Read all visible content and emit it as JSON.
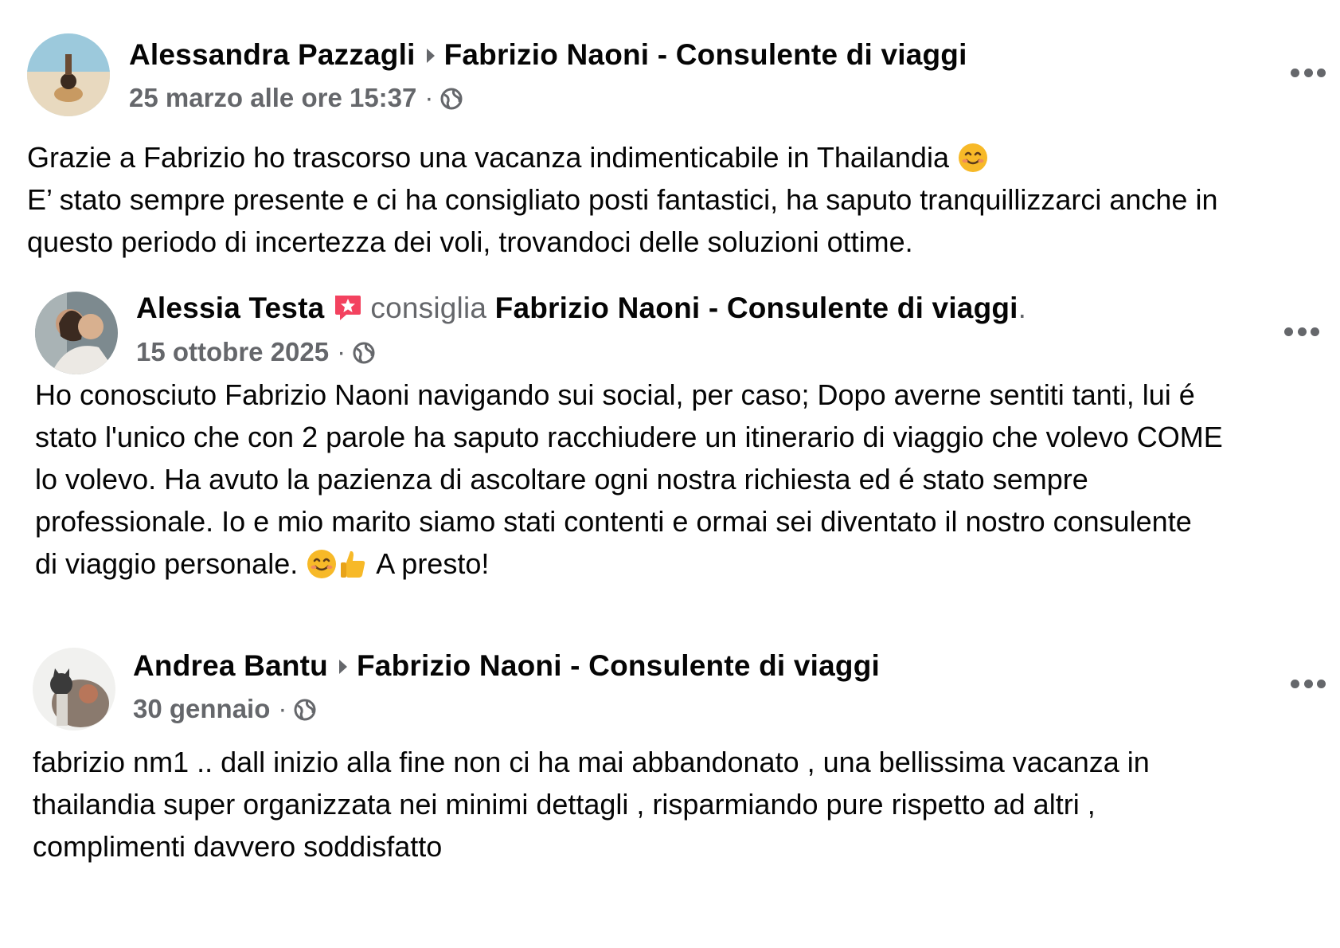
{
  "posts": [
    {
      "author": "Alessandra Pazzagli",
      "page": "Fabrizio Naoni - Consulente di viaggi",
      "date": "25 marzo alle ore 15:37",
      "separator": "·",
      "privacy_icon": "globe-icon",
      "lines": [
        "Grazie a Fabrizio ho trascorso una vacanza indimenticabile in Thailandia",
        "E’ stato sempre presente e ci ha consigliato posti fantastici, ha saputo tranquillizzarci anche in",
        "questo periodo di incertezza dei voli, trovandoci delle soluzioni ottime."
      ]
    },
    {
      "author": "Alessia Testa",
      "action": "consiglia",
      "page": "Fabrizio Naoni - Consulente di viaggi",
      "page_suffix": ".",
      "date": "15 ottobre 2025",
      "separator": "·",
      "privacy_icon": "globe-icon",
      "lines": [
        "Ho conosciuto Fabrizio Naoni navigando sui social, per caso; Dopo averne sentiti tanti, lui é",
        "stato l'unico che con 2 parole ha saputo racchiudere un itinerario di viaggio che volevo COME",
        "lo volevo. Ha avuto la pazienza di ascoltare ogni nostra richiesta ed é stato sempre",
        "professionale. Io e mio marito siamo stati contenti e ormai sei diventato il nostro consulente",
        "di viaggio personale.",
        "A presto!"
      ]
    },
    {
      "author": "Andrea Bantu",
      "page": "Fabrizio Naoni - Consulente di viaggi",
      "date": "30 gennaio",
      "separator": "·",
      "privacy_icon": "globe-icon",
      "lines": [
        "fabrizio nm1 ..  dall inizio alla fine non ci ha mai abbandonato , una bellissima vacanza in",
        "thailandia super organizzata nei minimi dettagli , risparmiando pure rispetto ad altri ,",
        "complimenti davvero soddisfatto"
      ]
    }
  ],
  "colors": {
    "text": "#050505",
    "muted": "#65676b",
    "recommend_badge": "#f3425f",
    "emoji_face": "#f7b928"
  }
}
